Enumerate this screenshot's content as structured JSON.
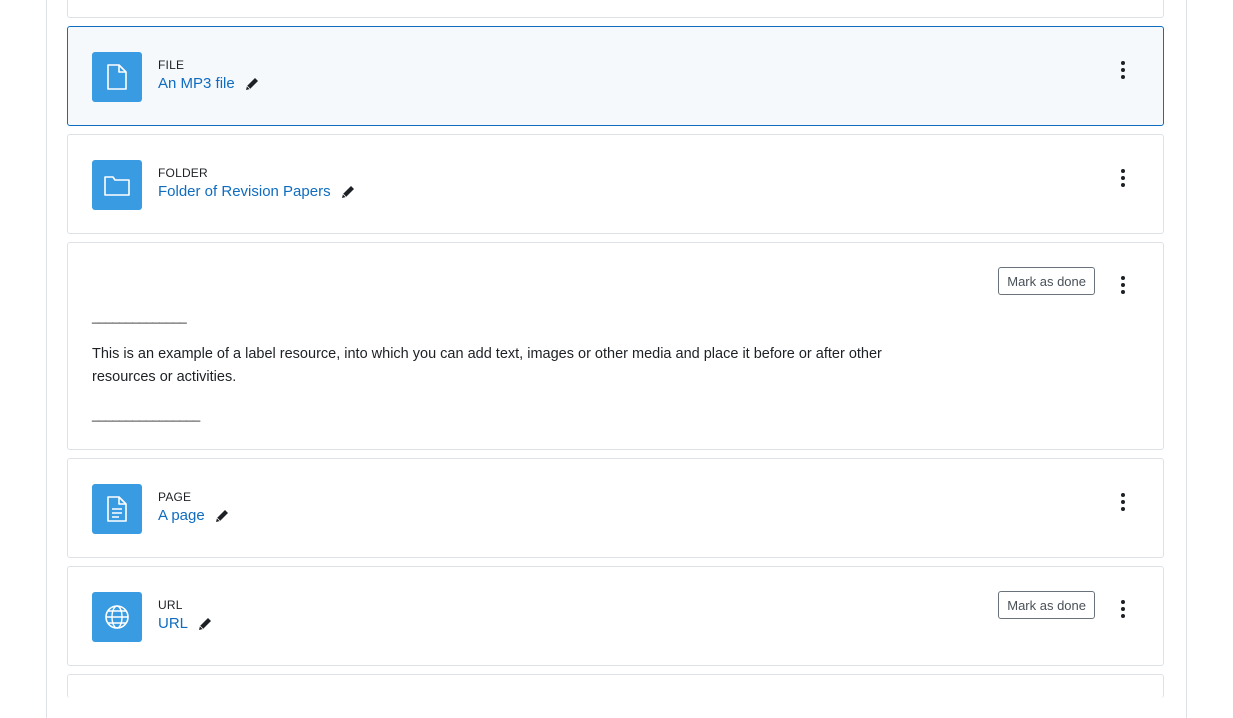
{
  "activities": [
    {
      "type": "FILE",
      "name": "An MP3 file",
      "icon": "file-icon",
      "highlighted": true
    },
    {
      "type": "FOLDER",
      "name": "Folder of Revision Papers",
      "icon": "folder-icon"
    },
    {
      "type": "LABEL",
      "rule_top": "______________",
      "text": "This is an example of a label resource, into which you can add text, images or other media and place it before or after other resources or activities.",
      "rule_bottom": "________________",
      "mark_done_label": "Mark as done"
    },
    {
      "type": "PAGE",
      "name": "A page",
      "icon": "page-icon"
    },
    {
      "type": "URL",
      "name": "URL",
      "icon": "globe-icon",
      "mark_done_label": "Mark as done"
    }
  ],
  "colors": {
    "accent": "#0f6cbf",
    "icon_bg": "#399be2",
    "highlight_bg": "#f5f9fc",
    "border": "#dee2e6"
  }
}
